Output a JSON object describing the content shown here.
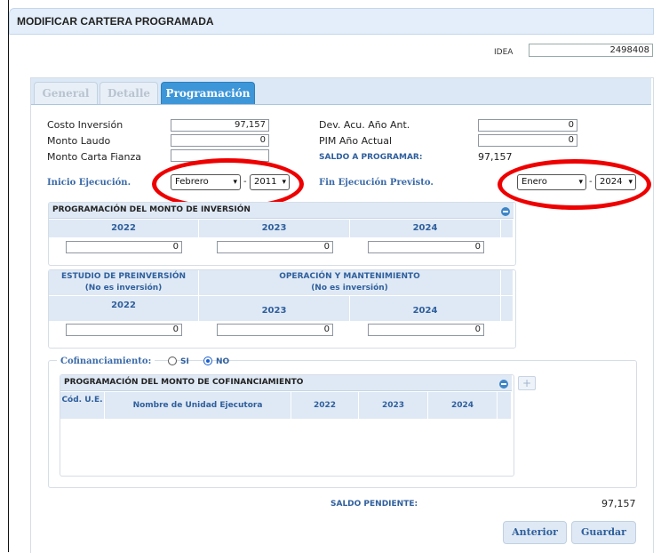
{
  "window": {
    "title": "MODIFICAR CARTERA PROGRAMADA"
  },
  "idea": {
    "label": "IDEA",
    "value": "2498408"
  },
  "tabs": [
    {
      "label": "General",
      "active": false
    },
    {
      "label": "Detalle",
      "active": false
    },
    {
      "label": "Programación",
      "active": true
    }
  ],
  "fields": {
    "costo_inversion": {
      "label": "Costo Inversión",
      "value": "97,157"
    },
    "monto_laudo": {
      "label": "Monto Laudo",
      "value": "0"
    },
    "monto_carta_fianza": {
      "label": "Monto Carta Fianza",
      "value": ""
    },
    "dev_acu": {
      "label": "Dev. Acu. Año Ant.",
      "value": "0"
    },
    "pim_actual": {
      "label": "PIM Año Actual",
      "value": "0"
    },
    "saldo_programar": {
      "label": "SALDO A PROGRAMAR:",
      "value": "97,157"
    }
  },
  "inicio": {
    "label": "Inicio Ejecución.",
    "month": "Febrero",
    "year": "2011",
    "sep": "-"
  },
  "fin": {
    "label": "Fin Ejecución Previsto.",
    "month": "Enero",
    "year": "2024",
    "sep": "-"
  },
  "inversion": {
    "title": "PROGRAMACIÓN DEL MONTO DE INVERSIÓN",
    "years": [
      "2022",
      "2023",
      "2024"
    ],
    "values": [
      "0",
      "0",
      "0"
    ]
  },
  "otros": {
    "col1_title": "ESTUDIO DE PREINVERSIÓN",
    "col1_sub": "(No es inversión)",
    "col2_title": "OPERACIÓN Y MANTENIMIENTO",
    "col2_sub": "(No es inversión)",
    "years": [
      "2022",
      "2023",
      "2024"
    ],
    "values": [
      "0",
      "0",
      "0"
    ]
  },
  "cofin": {
    "label": "Cofinanciamiento:",
    "option_si": "SI",
    "option_no": "NO",
    "selected": "NO",
    "title": "PROGRAMACIÓN DEL MONTO DE COFINANCIAMIENTO",
    "columns": [
      "Cód. U.E.",
      "Nombre de Unidad Ejecutora",
      "2022",
      "2023",
      "2024"
    ],
    "add_icon": "+"
  },
  "saldo_pendiente": {
    "label": "SALDO PENDIENTE:",
    "value": "97,157"
  },
  "buttons": {
    "anterior": "Anterior",
    "guardar": "Guardar"
  },
  "icons": {
    "dropdown": "▾"
  },
  "colors": {
    "accent": "#3d96d8",
    "highlight": "#ee0000",
    "label_blue": "#3a6aa8"
  }
}
